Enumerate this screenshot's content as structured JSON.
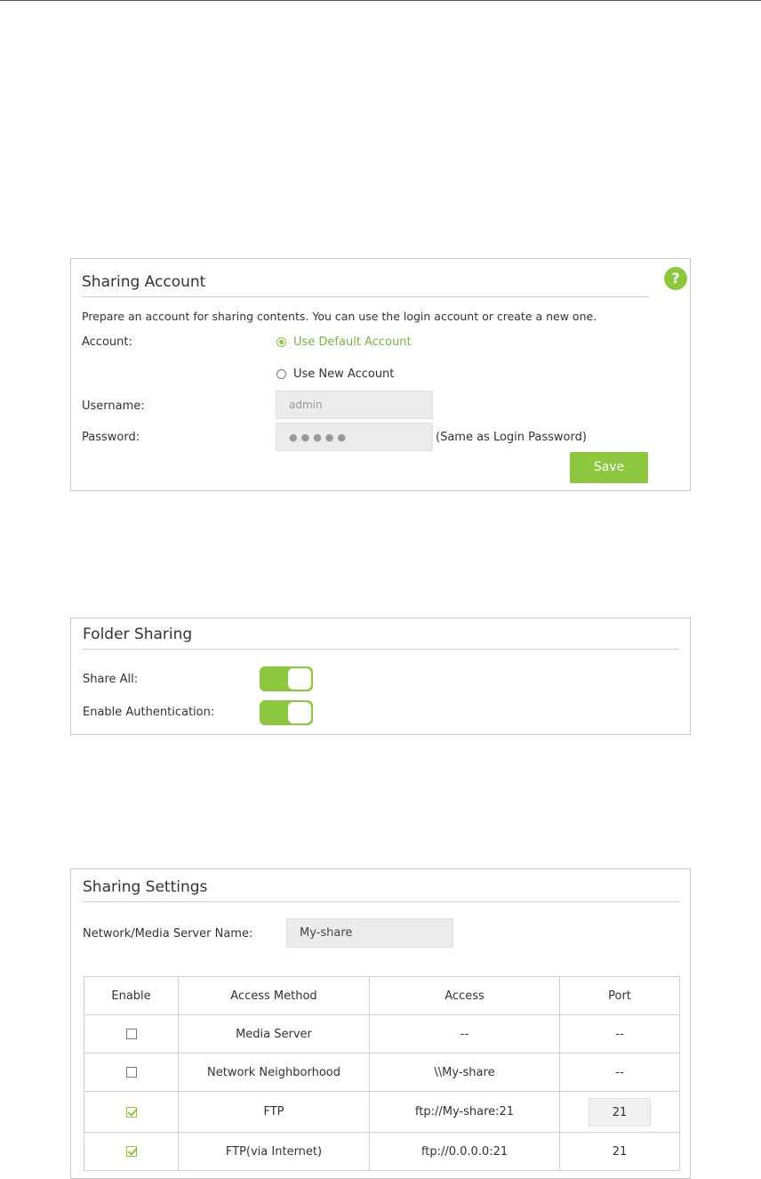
{
  "sharing_account": {
    "title": "Sharing Account",
    "help_label": "?",
    "description": "Prepare an account for sharing contents. You can use the login account or create a new one.",
    "account_label": "Account:",
    "option_default": "Use Default Account",
    "option_new": "Use New Account",
    "selected_option": "Use Default Account",
    "username_label": "Username:",
    "username_value": "admin",
    "password_label": "Password:",
    "password_value": "●●●●●",
    "password_note": "(Same as Login Password)",
    "save_label": "Save"
  },
  "folder_sharing": {
    "title": "Folder Sharing",
    "share_all_label": "Share All:",
    "share_all_on": true,
    "auth_label": "Enable Authentication:",
    "auth_on": true
  },
  "sharing_settings": {
    "title": "Sharing Settings",
    "server_name_label": "Network/Media Server Name:",
    "server_name_value": "My-share",
    "columns": [
      "Enable",
      "Access Method",
      "Access",
      "Port"
    ],
    "rows": [
      {
        "enabled": false,
        "method": "Media Server",
        "access": "--",
        "port": "--"
      },
      {
        "enabled": false,
        "method": "Network Neighborhood",
        "access": "\\\\My-share",
        "port": "--"
      },
      {
        "enabled": true,
        "method": "FTP",
        "access": "ftp://My-share:21",
        "port": "21"
      },
      {
        "enabled": true,
        "method": "FTP(via Internet)",
        "access": "ftp://0.0.0.0:21",
        "port": "21"
      }
    ]
  },
  "colors": {
    "accent": "#8dc63f",
    "border": "#c9c9c9"
  }
}
